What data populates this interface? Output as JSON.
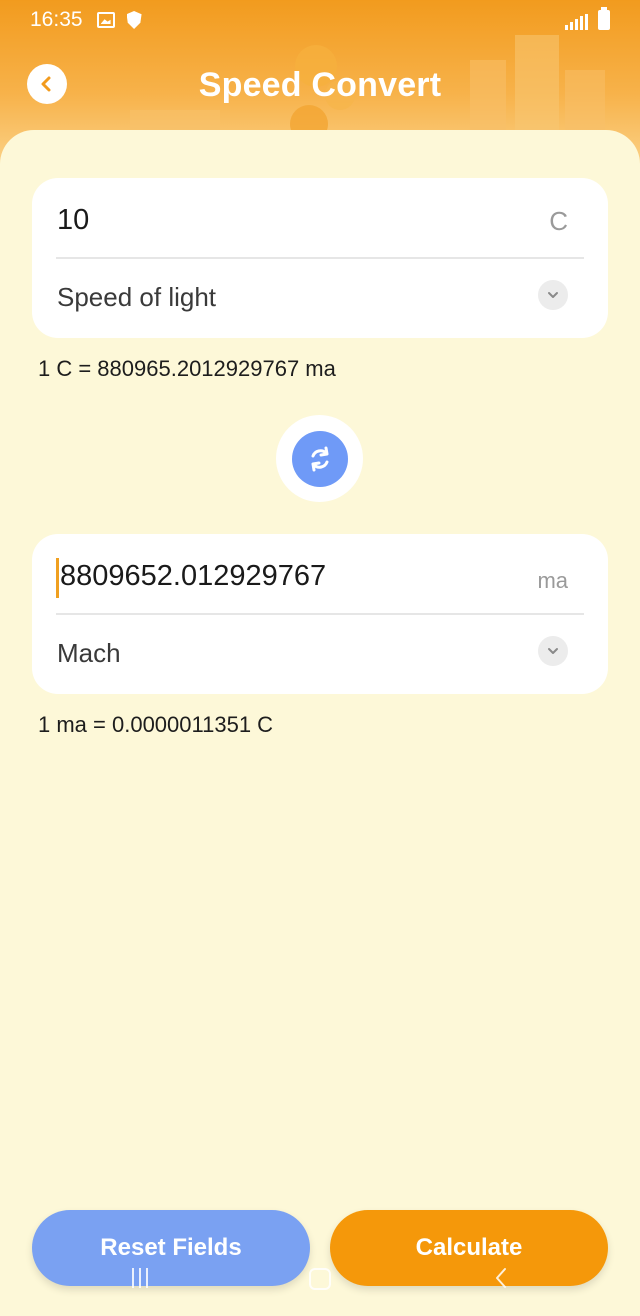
{
  "status_bar": {
    "time": "16:35"
  },
  "header": {
    "title": "Speed Convert"
  },
  "from_card": {
    "value": "10",
    "unit": "C",
    "selected_unit": "Speed of light"
  },
  "from_rate": "1 C = 880965.2012929767 ma",
  "to_card": {
    "value": "8809652.012929767",
    "unit": "ma",
    "selected_unit": "Mach"
  },
  "to_rate": "1 ma = 0.0000011351 C",
  "buttons": {
    "reset_label": "Reset Fields",
    "calculate_label": "Calculate"
  },
  "colors": {
    "header": "#f29b1e",
    "background": "#fdf8d8",
    "reset_button": "#7aa1f2",
    "calculate_button": "#f5980a",
    "swap_button": "#6f9af7"
  },
  "icons": {
    "back": "back-arrow-icon",
    "swap": "swap-icon",
    "dropdown": "chevron-down-icon"
  }
}
